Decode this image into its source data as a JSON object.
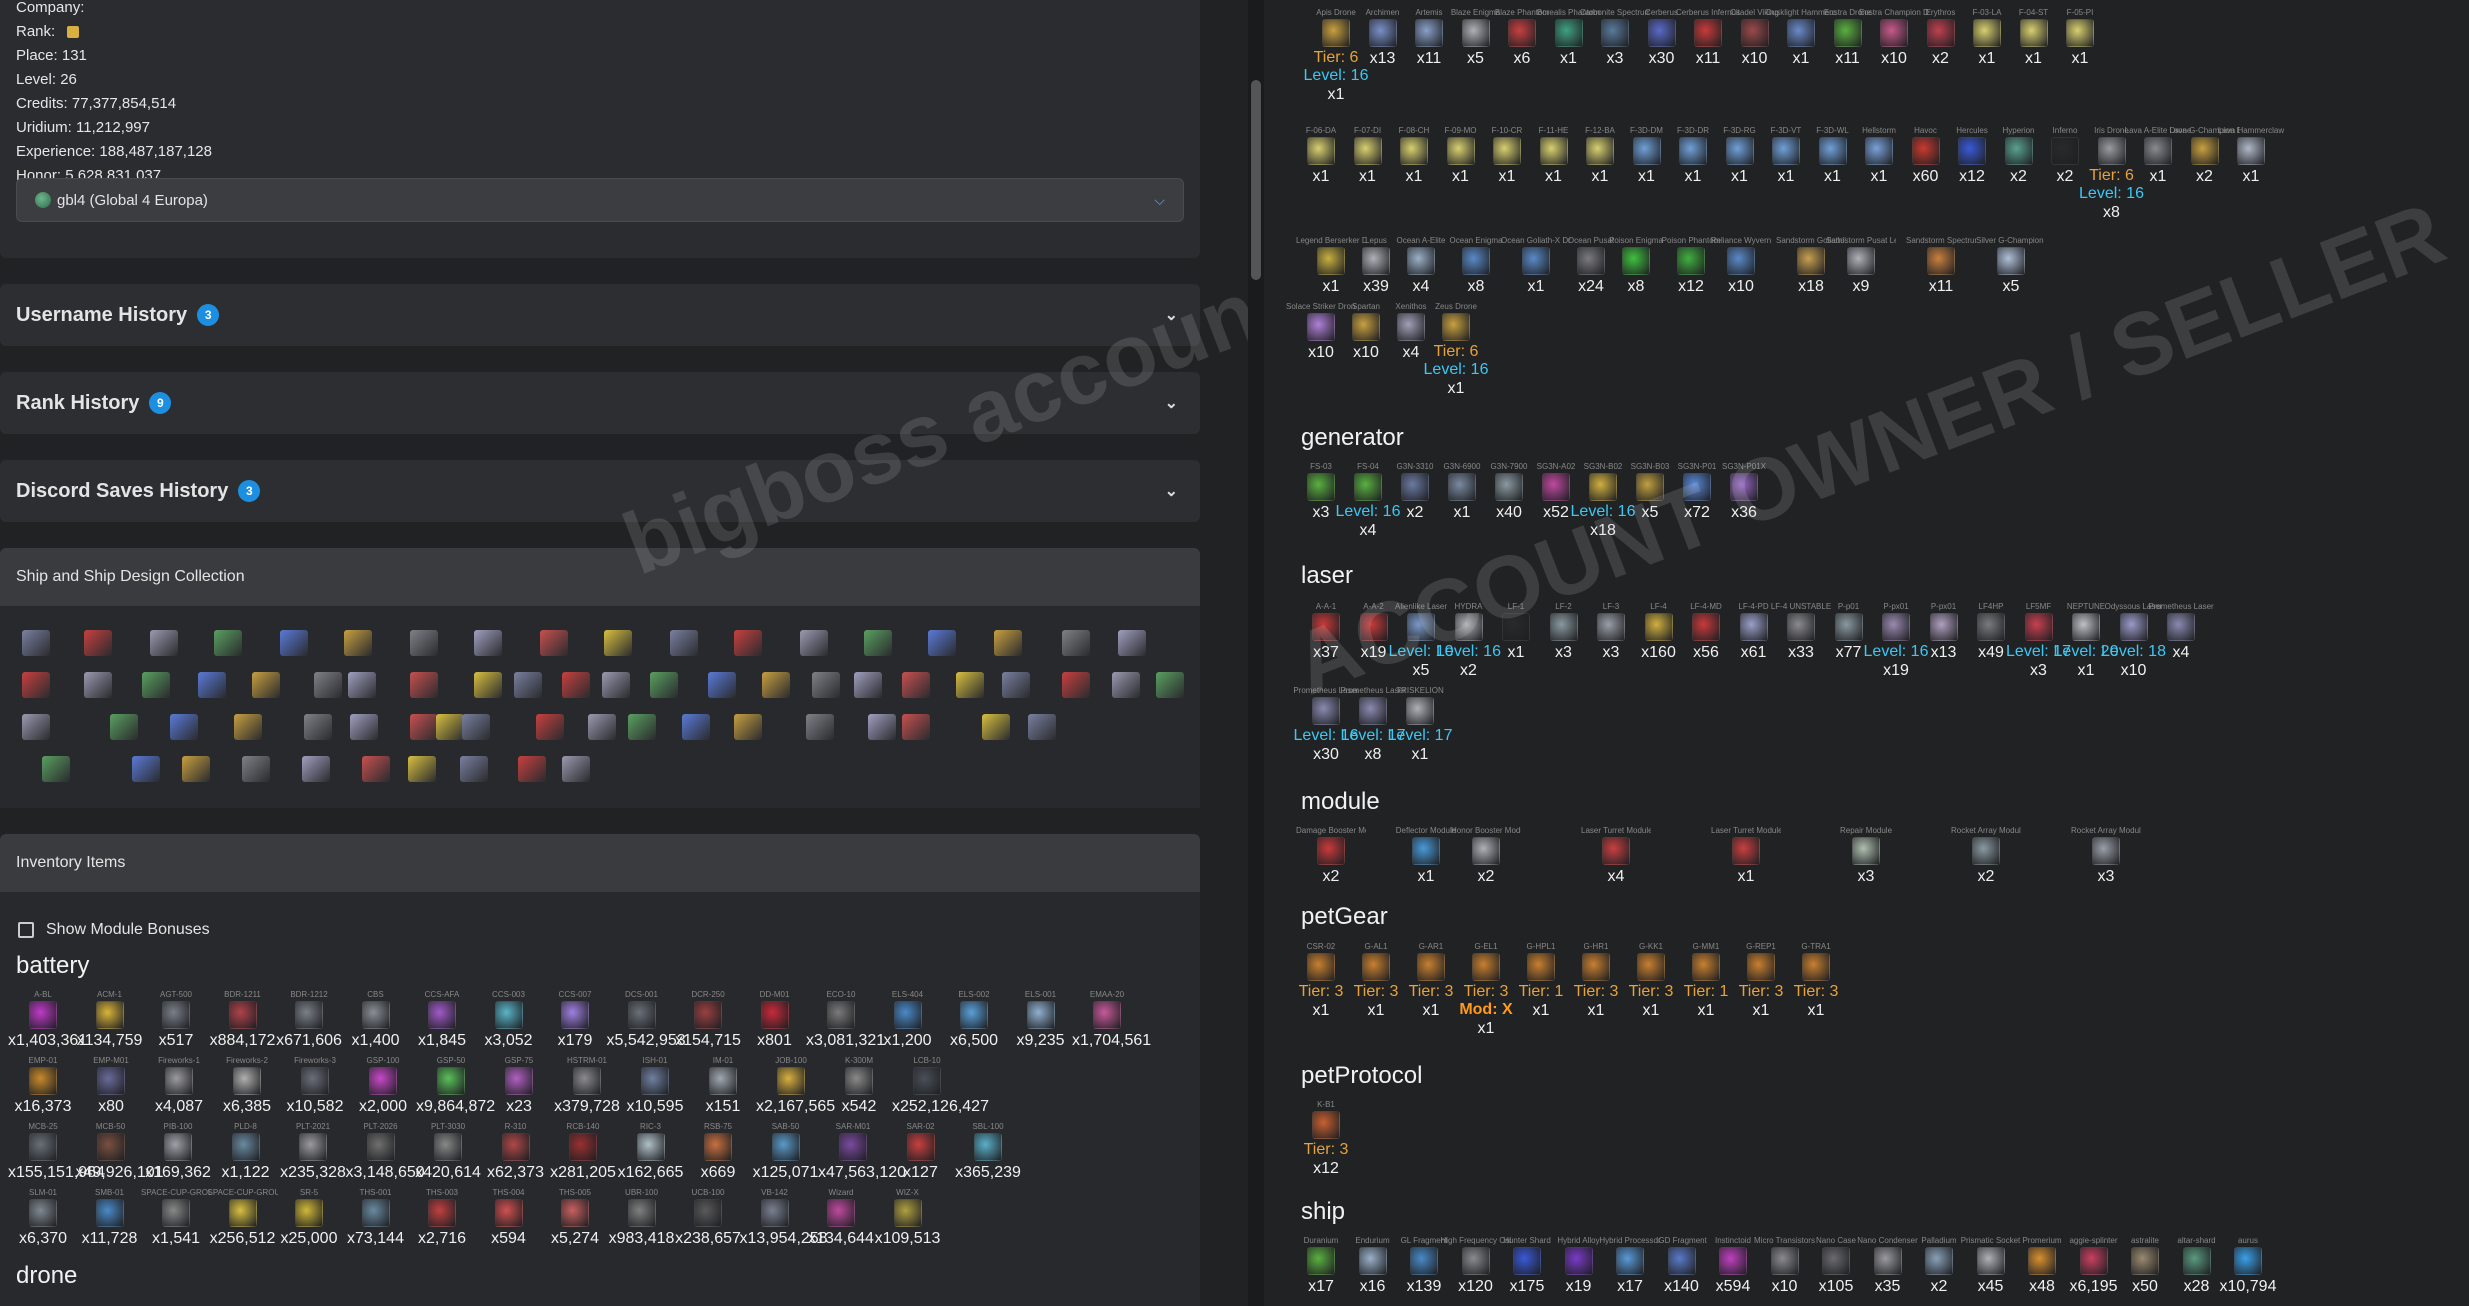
{
  "profile": {
    "company": "Company:",
    "rank": "Rank:",
    "place": "Place: 131",
    "level": "Level: 26",
    "credits": "Credits: 77,377,854,514",
    "uridium": "Uridium: 11,212,997",
    "experience": "Experience: 188,487,187,128",
    "honor": "Honor: 5,628,831,037",
    "server": "gbl4 (Global 4 Europa)"
  },
  "accordions": [
    {
      "label": "Username History",
      "count": "3"
    },
    {
      "label": "Rank History",
      "count": "9"
    },
    {
      "label": "Discord Saves History",
      "count": "3"
    }
  ],
  "ships_title": "Ship and Ship Design Collection",
  "inventory_title": "Inventory Items",
  "show_bonus": "Show Module Bonuses",
  "watermark_left": "bigboss accounts • Pashtetovich",
  "watermark_right": "ACCOUNT OWNER / SELLER",
  "left_categories": {
    "battery": "battery",
    "drone": "drone"
  },
  "battery": [
    {
      "n": "A-BL",
      "c": "x1,403,361",
      "col": "#c03ac8"
    },
    {
      "n": "ACM-1",
      "c": "x134,759",
      "col": "#d9b43a"
    },
    {
      "n": "AGT-500",
      "c": "x517",
      "col": "#7a7f88"
    },
    {
      "n": "BDR-1211",
      "c": "x884,172",
      "col": "#b0424a"
    },
    {
      "n": "BDR-1212",
      "c": "x671,606",
      "col": "#7a8088"
    },
    {
      "n": "CBS",
      "c": "x1,400",
      "col": "#8a8f96"
    },
    {
      "n": "CCS-AFA",
      "c": "x1,845",
      "col": "#a05ac8"
    },
    {
      "n": "CCS-003",
      "c": "x3,052",
      "col": "#5ab4c8"
    },
    {
      "n": "CCS-007",
      "c": "x179",
      "col": "#a080e0"
    },
    {
      "n": "DCS-001",
      "c": "x5,542,953",
      "col": "#6a7078"
    },
    {
      "n": "DCR-250",
      "c": "x154,715",
      "col": "#9a4040"
    },
    {
      "n": "DD-M01",
      "c": "x801",
      "col": "#c82a3a"
    },
    {
      "n": "ECO-10",
      "c": "x3,081,321",
      "col": "#7a7a7a"
    },
    {
      "n": "ELS-404",
      "c": "x1,200",
      "col": "#4a8ac8"
    },
    {
      "n": "ELS-002",
      "c": "x6,500",
      "col": "#5aa0d8"
    },
    {
      "n": "ELS-001",
      "c": "x9,235",
      "col": "#90b0d0"
    },
    {
      "n": "EMAA-20",
      "c": "x1,704,561",
      "col": "#c85a9a"
    },
    {
      "n": "EMP-01",
      "c": "x16,373",
      "col": "#c88a2a"
    },
    {
      "n": "EMP-M01",
      "c": "x80",
      "col": "#6a6a9a"
    },
    {
      "n": "Fireworks-1",
      "c": "x4,087",
      "col": "#9a9aa0"
    },
    {
      "n": "Fireworks-2",
      "c": "x6,385",
      "col": "#b0b0b0"
    },
    {
      "n": "Fireworks-3",
      "c": "x10,582",
      "col": "#6a6e78"
    },
    {
      "n": "GSP-100",
      "c": "x2,000",
      "col": "#c848c8"
    },
    {
      "n": "GSP-50",
      "c": "x9,864,872",
      "col": "#5ac05a"
    },
    {
      "n": "GSP-75",
      "c": "x23",
      "col": "#b060c0"
    },
    {
      "n": "HSTRM-01",
      "c": "x379,728",
      "col": "#8a8a90"
    },
    {
      "n": "ISH-01",
      "c": "x10,595",
      "col": "#7080a0"
    },
    {
      "n": "IM-01",
      "c": "x151",
      "col": "#a0a8b0"
    },
    {
      "n": "JOB-100",
      "c": "x2,167,565",
      "col": "#d8b040"
    },
    {
      "n": "K-300M",
      "c": "x542",
      "col": "#8a8a8a"
    },
    {
      "n": "LCB-10",
      "c": "x252,126,427",
      "col": "#4a5058"
    },
    {
      "n": "MCB-25",
      "c": "x155,151,964",
      "col": "#6a7078"
    },
    {
      "n": "MCB-50",
      "c": "x49,926,101",
      "col": "#7a5040"
    },
    {
      "n": "PIB-100",
      "c": "x169,362",
      "col": "#a0a0a8"
    },
    {
      "n": "PLD-8",
      "c": "x1,122",
      "col": "#6a8aa0"
    },
    {
      "n": "PLT-2021",
      "c": "x235,328",
      "col": "#9a9aa0"
    },
    {
      "n": "PLT-2026",
      "c": "x3,148,650",
      "col": "#707070"
    },
    {
      "n": "PLT-3030",
      "c": "x420,614",
      "col": "#888"
    },
    {
      "n": "R-310",
      "c": "x62,373",
      "col": "#b04848"
    },
    {
      "n": "RCB-140",
      "c": "x281,205",
      "col": "#9a3030"
    },
    {
      "n": "RIC-3",
      "c": "x162,665",
      "col": "#b0c0c8"
    },
    {
      "n": "RSB-75",
      "c": "x669",
      "col": "#c87040"
    },
    {
      "n": "SAB-50",
      "c": "x125,071",
      "col": "#5a9ac8"
    },
    {
      "n": "SAR-M01",
      "c": "x47,563,120",
      "col": "#7a4aa0"
    },
    {
      "n": "SAR-02",
      "c": "x127",
      "col": "#c84040"
    },
    {
      "n": "SBL-100",
      "c": "x365,239",
      "col": "#5ab0c8"
    },
    {
      "n": "SLM-01",
      "c": "x6,370",
      "col": "#808890"
    },
    {
      "n": "SMB-01",
      "c": "x11,728",
      "col": "#4a8ac8"
    },
    {
      "n": "SPACE-CUP-GROUP-C",
      "c": "x1,541",
      "col": "#888"
    },
    {
      "n": "SPACE-CUP-GROUP-D",
      "c": "x256,512",
      "col": "#d8c040"
    },
    {
      "n": "SR-5",
      "c": "x25,000",
      "col": "#d0b838"
    },
    {
      "n": "THS-001",
      "c": "x73,144",
      "col": "#6a8aa0"
    },
    {
      "n": "THS-003",
      "c": "x2,716",
      "col": "#c04040"
    },
    {
      "n": "THS-004",
      "c": "x594",
      "col": "#d05050"
    },
    {
      "n": "THS-005",
      "c": "x5,274",
      "col": "#c86060"
    },
    {
      "n": "UBR-100",
      "c": "x983,418",
      "col": "#808080"
    },
    {
      "n": "UCB-100",
      "c": "x238,657",
      "col": "#5a5a5a"
    },
    {
      "n": "VB-142",
      "c": "x13,954,258",
      "col": "#7a8090"
    },
    {
      "n": "Wizard",
      "c": "x134,644",
      "col": "#c04aa0"
    },
    {
      "n": "WIZ-X",
      "c": "x109,513",
      "col": "#b0a040"
    }
  ],
  "right": {
    "drones1": [
      {
        "n": "Apis Drone",
        "t": "Tier: 6",
        "l": "Level: 16",
        "c": "x1",
        "col": "#c8a040"
      },
      {
        "n": "Archimen",
        "c": "x13",
        "col": "#7a90c8"
      },
      {
        "n": "Artemis",
        "c": "x11",
        "col": "#8aa0c8"
      },
      {
        "n": "Blaze Enigma",
        "c": "x5",
        "col": "#b0b0b8"
      },
      {
        "n": "Blaze Phantom",
        "c": "x6",
        "col": "#c84040"
      },
      {
        "n": "Borealis Phantom",
        "c": "x1",
        "col": "#40a080"
      },
      {
        "n": "Carbonite Spectrum",
        "c": "x3",
        "col": "#5a7a9a"
      },
      {
        "n": "Cerberus",
        "c": "x30",
        "col": "#5a6ac8"
      },
      {
        "n": "Cerberus Infernus",
        "c": "x11",
        "col": "#c83a3a"
      },
      {
        "n": "Citadel Viking",
        "c": "x10",
        "col": "#9a4a4a"
      },
      {
        "n": "Dusklight Hammerclaw Drone",
        "c": "x1",
        "col": "#6a8ac8"
      },
      {
        "n": "Eostra Drone",
        "c": "x11",
        "col": "#5ab040"
      },
      {
        "n": "Eostra Champion Drone",
        "c": "x10",
        "col": "#c85a8a"
      },
      {
        "n": "Erythros",
        "c": "x2",
        "col": "#c04050"
      },
      {
        "n": "F-03-LA",
        "c": "x1",
        "col": "#d8d070"
      },
      {
        "n": "F-04-ST",
        "c": "x1",
        "col": "#d8d070"
      },
      {
        "n": "F-05-PI",
        "c": "x1",
        "col": "#d8d070"
      }
    ],
    "drones2": [
      {
        "n": "F-06-DA",
        "c": "x1",
        "col": "#d8d070"
      },
      {
        "n": "F-07-DI",
        "c": "x1",
        "col": "#d8d070"
      },
      {
        "n": "F-08-CH",
        "c": "x1",
        "col": "#d8d070"
      },
      {
        "n": "F-09-MO",
        "c": "x1",
        "col": "#d8d070"
      },
      {
        "n": "F-10-CR",
        "c": "x1",
        "col": "#d8d070"
      },
      {
        "n": "F-11-HE",
        "c": "x1",
        "col": "#d8d070"
      },
      {
        "n": "F-12-BA",
        "c": "x1",
        "col": "#d8d070"
      },
      {
        "n": "F-3D-DM",
        "c": "x1",
        "col": "#70a0d8"
      },
      {
        "n": "F-3D-DR",
        "c": "x1",
        "col": "#70a0d8"
      },
      {
        "n": "F-3D-RG",
        "c": "x1",
        "col": "#70a0d8"
      },
      {
        "n": "F-3D-VT",
        "c": "x1",
        "col": "#70a0d8"
      },
      {
        "n": "F-3D-WL",
        "c": "x1",
        "col": "#70a0d8"
      },
      {
        "n": "Hellstorm",
        "c": "x1",
        "col": "#7aa0d8"
      },
      {
        "n": "Havoc",
        "c": "x60",
        "col": "#c83a30"
      },
      {
        "n": "Hercules",
        "c": "x12",
        "col": "#3a5ad8"
      },
      {
        "n": "Hyperion",
        "c": "x2",
        "col": "#5aa090"
      },
      {
        "n": "Inferno",
        "c": "x2",
        "col": "#2a2a2a"
      },
      {
        "n": "Iris Drone",
        "t": "Tier: 6",
        "l": "Level: 16",
        "c": "x8",
        "col": "#9a9aa0"
      },
      {
        "n": "Lava A-Elite Drone",
        "c": "x1",
        "col": "#8a8a90"
      },
      {
        "n": "Lava G-Champion Drone",
        "c": "x2",
        "col": "#c8a040"
      },
      {
        "n": "Lava Hammerclaw",
        "c": "x1",
        "col": "#b0b8c8"
      }
    ],
    "drones3": [
      {
        "n": "Legend Berserker Drone",
        "c": "x1",
        "col": "#c8b040"
      },
      {
        "n": "Lepus",
        "c": "x39",
        "col": "#b0b0b8"
      },
      {
        "n": "Ocean A-Elite",
        "c": "x4",
        "col": "#9ab0c8"
      },
      {
        "n": "Ocean Enigma",
        "c": "x8",
        "col": "#5a8ac8"
      },
      {
        "n": "Ocean Goliath-X Drone",
        "c": "x1",
        "col": "#5a8ac8"
      },
      {
        "n": "Ocean Pusat",
        "c": "x24",
        "col": "#7a7a80"
      },
      {
        "n": "Poison Enigma",
        "c": "x8",
        "col": "#40c040"
      },
      {
        "n": "Poison Phantom",
        "c": "x12",
        "col": "#40b040"
      },
      {
        "n": "Reliance Wyvern",
        "c": "x10",
        "col": "#5a8ac8"
      },
      {
        "n": "Sandstorm Goliath-X Drone",
        "c": "x18",
        "col": "#c8a050"
      },
      {
        "n": "Sandstorm Pusat Legend Drone",
        "c": "x9",
        "col": "#b0b0b8"
      },
      {
        "n": "Sandstorm Spectrum Drone Design",
        "c": "x11",
        "col": "#c88040"
      },
      {
        "n": "Silver G-Champion Drone",
        "c": "x5",
        "col": "#b0c0d8"
      }
    ],
    "drones4": [
      {
        "n": "Solace Striker Drone",
        "c": "x10",
        "col": "#b080d8"
      },
      {
        "n": "Spartan",
        "c": "x10",
        "col": "#c8a040"
      },
      {
        "n": "Xenithos",
        "c": "x4",
        "col": "#a0a0b8"
      },
      {
        "n": "Zeus Drone",
        "t": "Tier: 6",
        "l": "Level: 16",
        "c": "x1",
        "col": "#c8a040"
      }
    ],
    "generator": [
      {
        "n": "FS-03",
        "c": "x3",
        "col": "#5ab040"
      },
      {
        "n": "FS-04",
        "l": "Level: 16",
        "c": "x4",
        "col": "#5ab040"
      },
      {
        "n": "G3N-3310",
        "c": "x2",
        "col": "#6a7aa0"
      },
      {
        "n": "G3N-6900",
        "c": "x1",
        "col": "#7a8aa0"
      },
      {
        "n": "G3N-7900",
        "c": "x40",
        "col": "#8a9aa0"
      },
      {
        "n": "SG3N-A02",
        "c": "x52",
        "col": "#c04aa0"
      },
      {
        "n": "SG3N-B02",
        "l": "Level: 16",
        "c": "x18",
        "col": "#d0b040"
      },
      {
        "n": "SG3N-B03",
        "c": "x5",
        "col": "#c0a040"
      },
      {
        "n": "SG3N-P01",
        "c": "x72",
        "col": "#5a8ad8"
      },
      {
        "n": "SG3N-P01X",
        "c": "x36",
        "col": "#9a6ac8"
      }
    ],
    "laser1": [
      {
        "n": "A-A-1",
        "c": "x37",
        "col": "#c83a3a"
      },
      {
        "n": "A-A-2",
        "c": "x19",
        "col": "#c83a3a"
      },
      {
        "n": "Alienlike Laser",
        "l": "Level: 10",
        "c": "x5",
        "col": "#7a9ac8"
      },
      {
        "n": "HYDRA",
        "l": "Level: 16",
        "c": "x2",
        "col": "#b0b0b8"
      },
      {
        "n": "LF-1",
        "c": "x1",
        "col": "#2a2a2a"
      },
      {
        "n": "LF-2",
        "c": "x3",
        "col": "#8a9aa0"
      },
      {
        "n": "LF-3",
        "c": "x3",
        "col": "#9aa0a8"
      },
      {
        "n": "LF-4",
        "c": "x160",
        "col": "#d0b040"
      },
      {
        "n": "LF-4-MD",
        "c": "x56",
        "col": "#c83a3a"
      },
      {
        "n": "LF-4-PD",
        "c": "x61",
        "col": "#9aa0c8"
      },
      {
        "n": "LF-4 UNSTABLE",
        "c": "x33",
        "col": "#8a8a90"
      },
      {
        "n": "P-p01",
        "c": "x77",
        "col": "#8a9aa0"
      },
      {
        "n": "P-px01",
        "l": "Level: 16",
        "c": "x19",
        "col": "#9a8ab0"
      },
      {
        "n": "P-px01",
        "c": "x13",
        "col": "#b0a0c0"
      },
      {
        "n": "LF4HP",
        "c": "x49",
        "col": "#7a7a80"
      },
      {
        "n": "LF5MF",
        "l": "Level: 17",
        "c": "x3",
        "col": "#c84050"
      },
      {
        "n": "NEPTUNE",
        "l": "Level: 20",
        "c": "x1",
        "col": "#c0c0c8"
      },
      {
        "n": "Odyssous Laser",
        "l": "Level: 18",
        "c": "x10",
        "col": "#9a9ac8"
      },
      {
        "n": "Prometheus Laser",
        "c": "x4",
        "col": "#8a8ab0"
      }
    ],
    "laser2": [
      {
        "n": "Prometheus Laser",
        "l": "Level: 16",
        "c": "x30",
        "col": "#8a8ab0"
      },
      {
        "n": "Prometheus Laser",
        "l": "Level: 17",
        "c": "x8",
        "col": "#8a8ab0"
      },
      {
        "n": "TRISKELION",
        "l": "Level: 17",
        "c": "x1",
        "col": "#b0b0b8"
      }
    ],
    "module": [
      {
        "n": "Damage Booster Module",
        "c": "x2",
        "col": "#c83a3a"
      },
      {
        "n": "Deflector Module",
        "c": "x1",
        "col": "#4a9ad8"
      },
      {
        "n": "Honor Booster Module",
        "c": "x2",
        "col": "#b0b0b8"
      },
      {
        "n": "Laser Turret Module - High Range",
        "c": "x4",
        "col": "#c84040"
      },
      {
        "n": "Laser Turret Module - Mid Range",
        "c": "x1",
        "col": "#c84040"
      },
      {
        "n": "Repair Module",
        "c": "x3",
        "col": "#b0c0b0"
      },
      {
        "n": "Rocket Array Module - Low Accuracy",
        "c": "x2",
        "col": "#8a9aa0"
      },
      {
        "n": "Rocket Array Module - Mid Accuracy",
        "c": "x3",
        "col": "#9aa0a8"
      }
    ],
    "petGear": [
      {
        "n": "CSR-02",
        "t": "Tier: 3",
        "c": "x1",
        "col": "#c88030"
      },
      {
        "n": "G-AL1",
        "t": "Tier: 3",
        "c": "x1",
        "col": "#c88030"
      },
      {
        "n": "G-AR1",
        "t": "Tier: 3",
        "c": "x1",
        "col": "#c88030"
      },
      {
        "n": "G-EL1",
        "t": "Tier: 3",
        "m": "Mod: X",
        "c": "x1",
        "col": "#c88030"
      },
      {
        "n": "G-HPL1",
        "t": "Tier: 1",
        "c": "x1",
        "col": "#c88030"
      },
      {
        "n": "G-HR1",
        "t": "Tier: 3",
        "c": "x1",
        "col": "#c88030"
      },
      {
        "n": "G-KK1",
        "t": "Tier: 3",
        "c": "x1",
        "col": "#c88030"
      },
      {
        "n": "G-MM1",
        "t": "Tier: 1",
        "c": "x1",
        "col": "#c88030"
      },
      {
        "n": "G-REP1",
        "t": "Tier: 3",
        "c": "x1",
        "col": "#c88030"
      },
      {
        "n": "G-TRA1",
        "t": "Tier: 3",
        "c": "x1",
        "col": "#c88030"
      }
    ],
    "petProtocol": [
      {
        "n": "K-B1",
        "t": "Tier: 3",
        "c": "x12",
        "col": "#c86030"
      }
    ],
    "ship": [
      {
        "n": "Duranium",
        "c": "x17",
        "col": "#5ab040"
      },
      {
        "n": "Endurium",
        "c": "x16",
        "col": "#9ab0c8"
      },
      {
        "n": "GL Fragment",
        "c": "x139",
        "col": "#4a8ac8"
      },
      {
        "n": "High Frequency Cable",
        "c": "x120",
        "col": "#8a8a90"
      },
      {
        "n": "Hunter Shard",
        "c": "x175",
        "col": "#3a5ad8"
      },
      {
        "n": "Hybrid Alloy",
        "c": "x19",
        "col": "#7a3ac8"
      },
      {
        "n": "Hybrid Processor",
        "c": "x17",
        "col": "#5a9ad8"
      },
      {
        "n": "IGD Fragment",
        "c": "x140",
        "col": "#5a7ac8"
      },
      {
        "n": "Instinctoid",
        "c": "x594",
        "col": "#c040c0"
      },
      {
        "n": "Micro Transistors",
        "c": "x10",
        "col": "#8a8a90"
      },
      {
        "n": "Nano Case",
        "c": "x105",
        "col": "#6a6a70"
      },
      {
        "n": "Nano Condenser",
        "c": "x35",
        "col": "#9a9aa0"
      },
      {
        "n": "Palladium",
        "c": "x2",
        "col": "#8aa0b8"
      },
      {
        "n": "Prismatic Socket",
        "c": "x45",
        "col": "#b0b0b8"
      },
      {
        "n": "Promerium",
        "c": "x48",
        "col": "#d89030"
      },
      {
        "n": "aggie-splinter",
        "c": "x6,195",
        "col": "#c84060"
      },
      {
        "n": "astralite",
        "c": "x50",
        "col": "#9a8a70"
      },
      {
        "n": "altar-shard",
        "c": "x28",
        "col": "#5a9a80"
      },
      {
        "n": "aurus",
        "c": "x10,794",
        "col": "#3aa0e8"
      }
    ]
  },
  "right_categories": {
    "generator": "generator",
    "laser": "laser",
    "module": "module",
    "petGear": "petGear",
    "petProtocol": "petProtocol",
    "ship": "ship"
  }
}
